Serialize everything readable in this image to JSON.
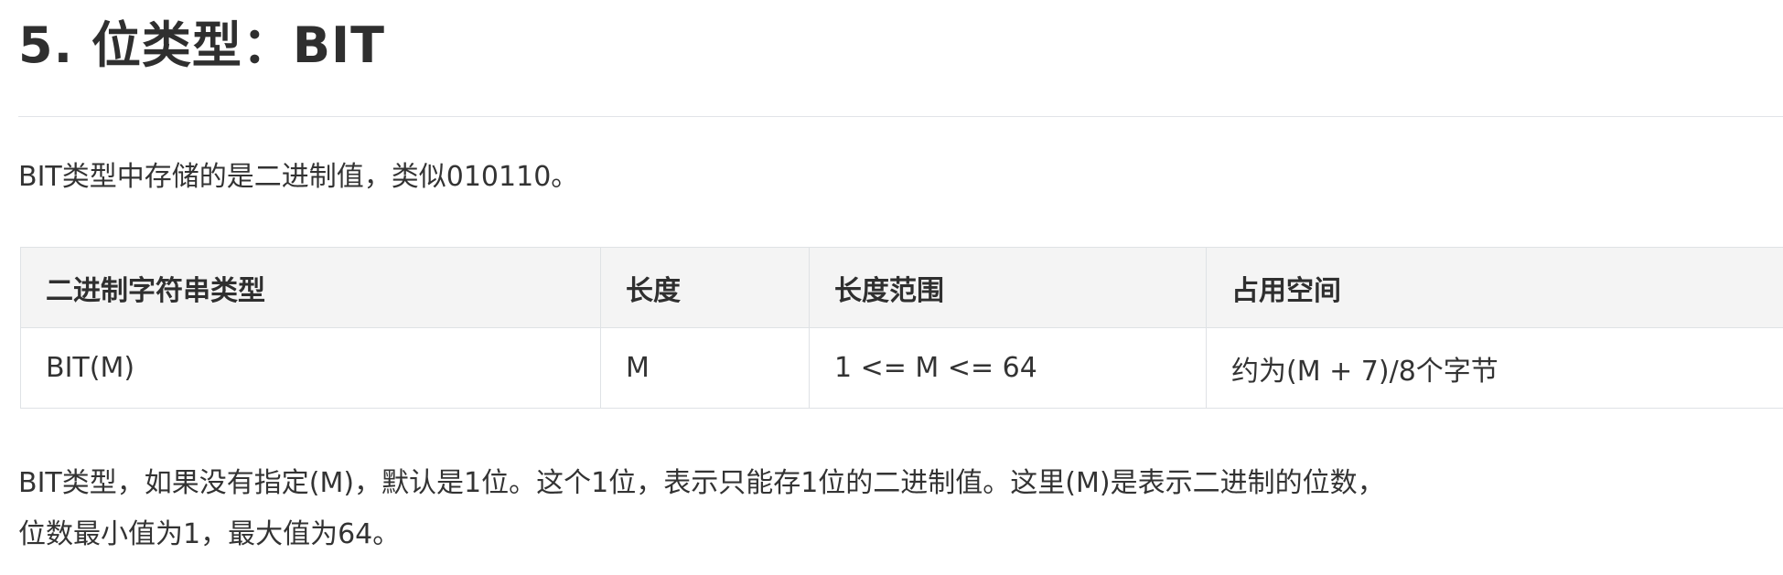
{
  "section": {
    "title": "5. 位类型：BIT"
  },
  "intro_text": "BIT类型中存储的是二进制值，类似010110。",
  "table": {
    "headers": [
      "二进制字符串类型",
      "长度",
      "长度范围",
      "占用空间"
    ],
    "rows": [
      [
        "BIT(M)",
        "M",
        "1 <= M <= 64",
        "约为(M + 7)/8个字节"
      ]
    ]
  },
  "note": {
    "line1": "BIT类型，如果没有指定(M)，默认是1位。这个1位，表示只能存1位的二进制值。这里(M)是表示二进制的位数，",
    "line2": "位数最小值为1，最大值为64。"
  }
}
